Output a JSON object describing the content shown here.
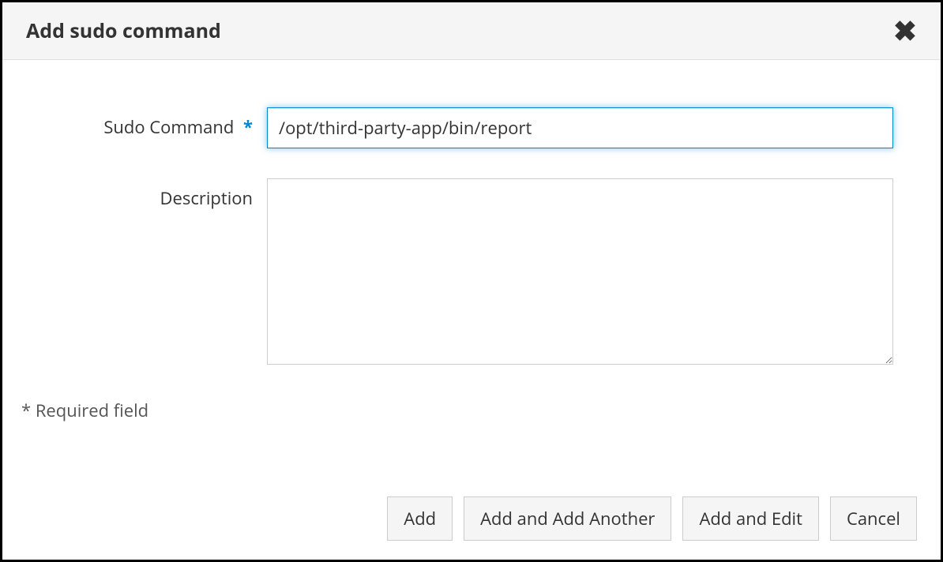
{
  "dialog": {
    "title": "Add sudo command"
  },
  "form": {
    "sudo_command": {
      "label": "Sudo Command",
      "value": "/opt/third-party-app/bin/report",
      "required": true
    },
    "description": {
      "label": "Description",
      "value": ""
    },
    "required_note": "* Required field"
  },
  "buttons": {
    "add": "Add",
    "add_another": "Add and Add Another",
    "add_edit": "Add and Edit",
    "cancel": "Cancel"
  }
}
